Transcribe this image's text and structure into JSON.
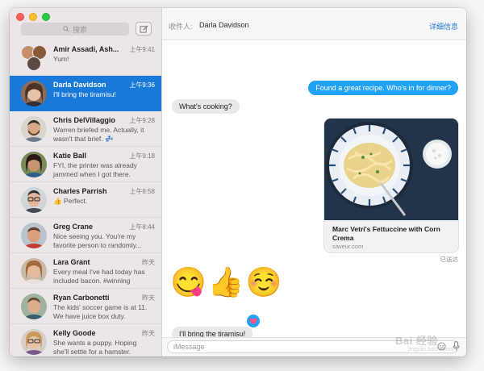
{
  "sidebar": {
    "search_placeholder": "搜索",
    "conversations": [
      {
        "name": "Amir Assadi, Ash...",
        "time": "上午9:41",
        "preview": "Yum!"
      },
      {
        "name": "Darla Davidson",
        "time": "上午9:36",
        "preview": "I'll bring the tiramisu!"
      },
      {
        "name": "Chris DelVillaggio",
        "time": "上午9:28",
        "preview": "Warren briefed me. Actually, it wasn't that brief. 💤"
      },
      {
        "name": "Katie Ball",
        "time": "上午9:18",
        "preview": "FYI, the printer was already jammed when I got there."
      },
      {
        "name": "Charles Parrish",
        "time": "上午8:58",
        "preview": "👍 Perfect."
      },
      {
        "name": "Greg Crane",
        "time": "上午8:44",
        "preview": "Nice seeing you. You're my favorite person to randomly..."
      },
      {
        "name": "Lara Grant",
        "time": "昨天",
        "preview": "Every meal I've had today has included bacon. #winning"
      },
      {
        "name": "Ryan Carbonetti",
        "time": "昨天",
        "preview": "The kids' soccer game is at 11. We have juice box duty."
      },
      {
        "name": "Kelly Goode",
        "time": "昨天",
        "preview": "She wants a puppy. Hoping she'll settle for a hamster."
      }
    ]
  },
  "header": {
    "to_label": "收件人:",
    "to_name": "Darla Davidson",
    "details_label": "详细信息"
  },
  "chat": {
    "messages": [
      {
        "direction": "out",
        "text": "Found a great recipe. Who's in for dinner?"
      },
      {
        "direction": "in",
        "text": "What's cooking?"
      }
    ],
    "link_card": {
      "title": "Marc Vetri's Fettuccine with Corn Crema",
      "site": "saveur.com"
    },
    "delivered_label": "已送达",
    "emoji_message": "😋👍☺️",
    "last_message": "I'll bring the tiramisu!"
  },
  "input": {
    "placeholder": "iMessage"
  },
  "watermark": {
    "text": "Bai 经验",
    "sub": "jingyan.baidu.com"
  },
  "colors": {
    "accent": "#1979d8",
    "bubble_blue": "#21a2f5",
    "bubble_gray": "#e8e7ea"
  }
}
